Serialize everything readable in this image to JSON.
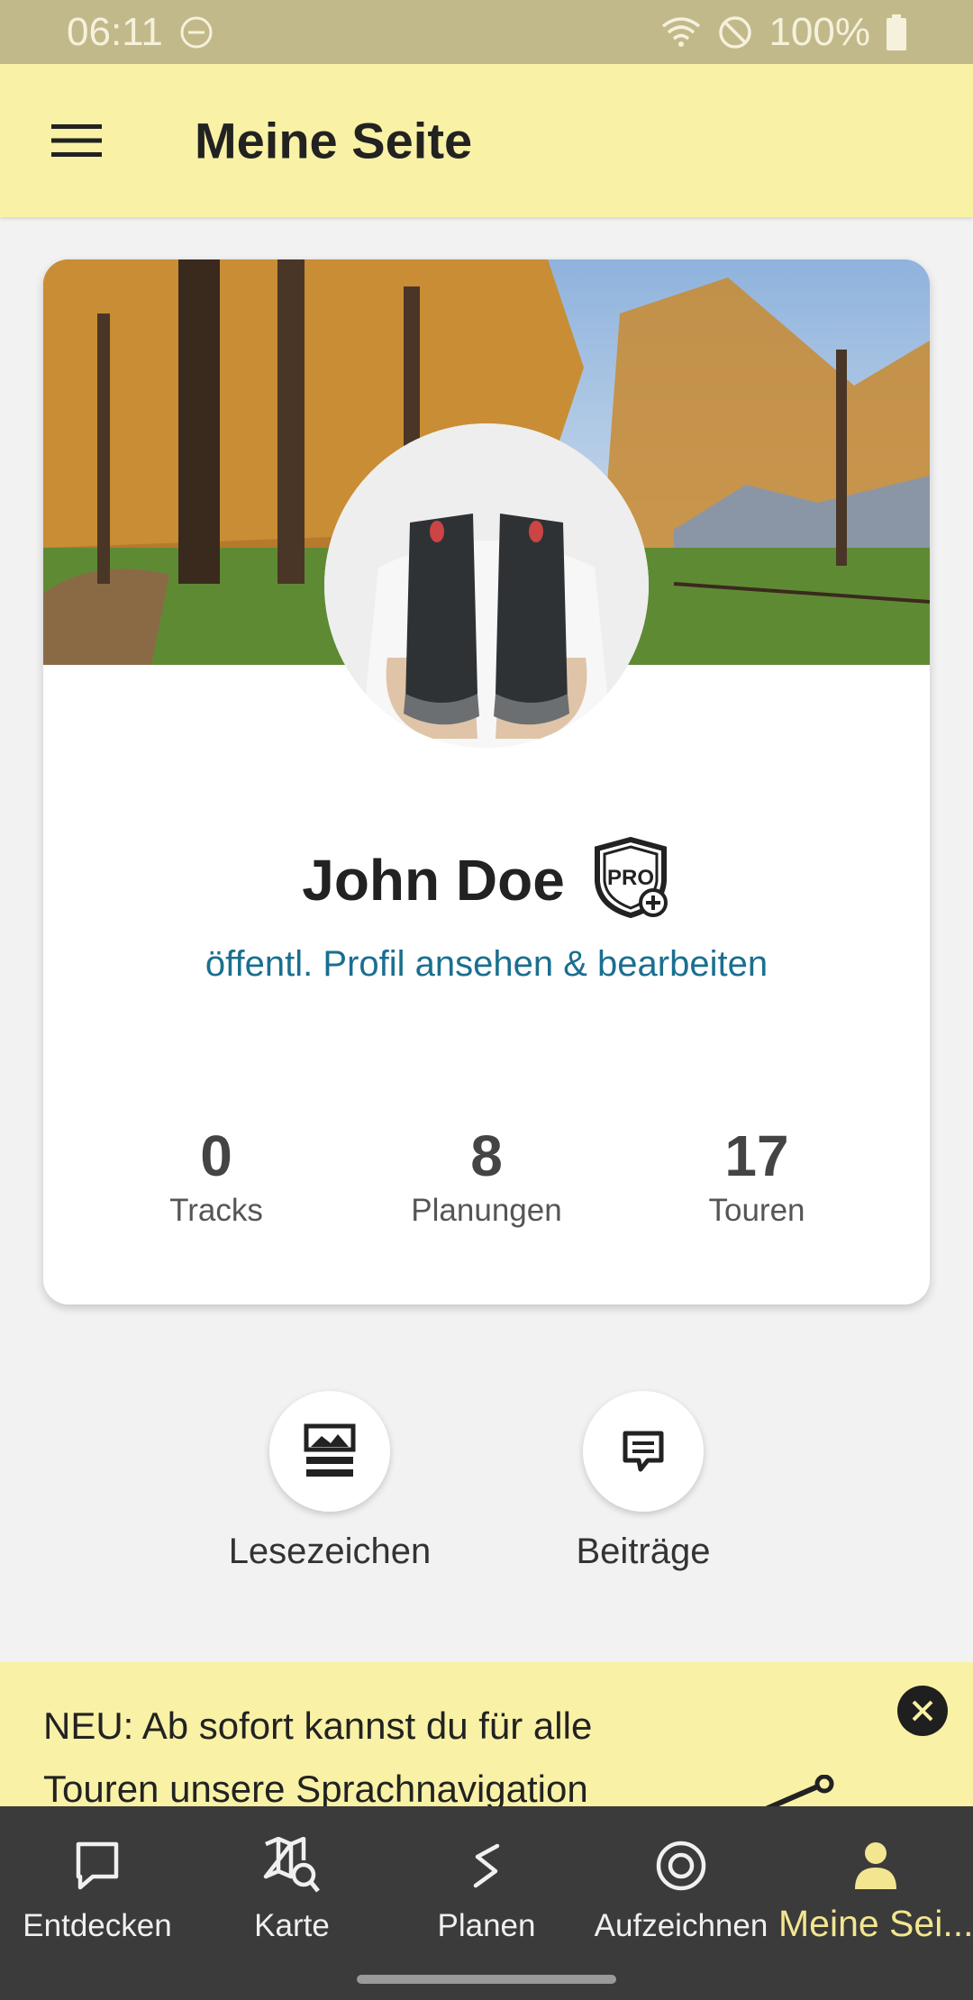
{
  "status_bar": {
    "time": "06:11",
    "battery": "100%",
    "icons": [
      "do-not-disturb-icon",
      "wifi-icon",
      "blocked-icon",
      "battery-icon"
    ]
  },
  "app_bar": {
    "title": "Meine Seite",
    "menu_icon": "menu-icon"
  },
  "profile": {
    "name": "John Doe",
    "badge": "PRO",
    "link_text": "öffentl. Profil ansehen & bearbeiten",
    "stats": [
      {
        "value": "0",
        "label": "Tracks"
      },
      {
        "value": "8",
        "label": "Planungen"
      },
      {
        "value": "17",
        "label": "Touren"
      }
    ]
  },
  "actions": [
    {
      "label": "Lesezeichen",
      "icon": "bookmark-list-icon"
    },
    {
      "label": "Beiträge",
      "icon": "comment-icon"
    }
  ],
  "banner": {
    "line1": "NEU: Ab sofort kannst du für alle",
    "line2": "Touren unsere Sprachnavigation"
  },
  "bottom_nav": [
    {
      "label": "Entdecken",
      "icon": "chat-bubble-icon"
    },
    {
      "label": "Karte",
      "icon": "map-search-icon"
    },
    {
      "label": "Planen",
      "icon": "route-icon"
    },
    {
      "label": "Aufzeichnen",
      "icon": "record-icon"
    },
    {
      "label": "Meine Sei...",
      "icon": "person-icon",
      "active": true
    }
  ],
  "colors": {
    "status_bar": "#c2b98a",
    "app_bar": "#f9f1a5",
    "link": "#1a6f8f",
    "nav_background": "#3b3b3b",
    "nav_active": "#f3e690"
  }
}
